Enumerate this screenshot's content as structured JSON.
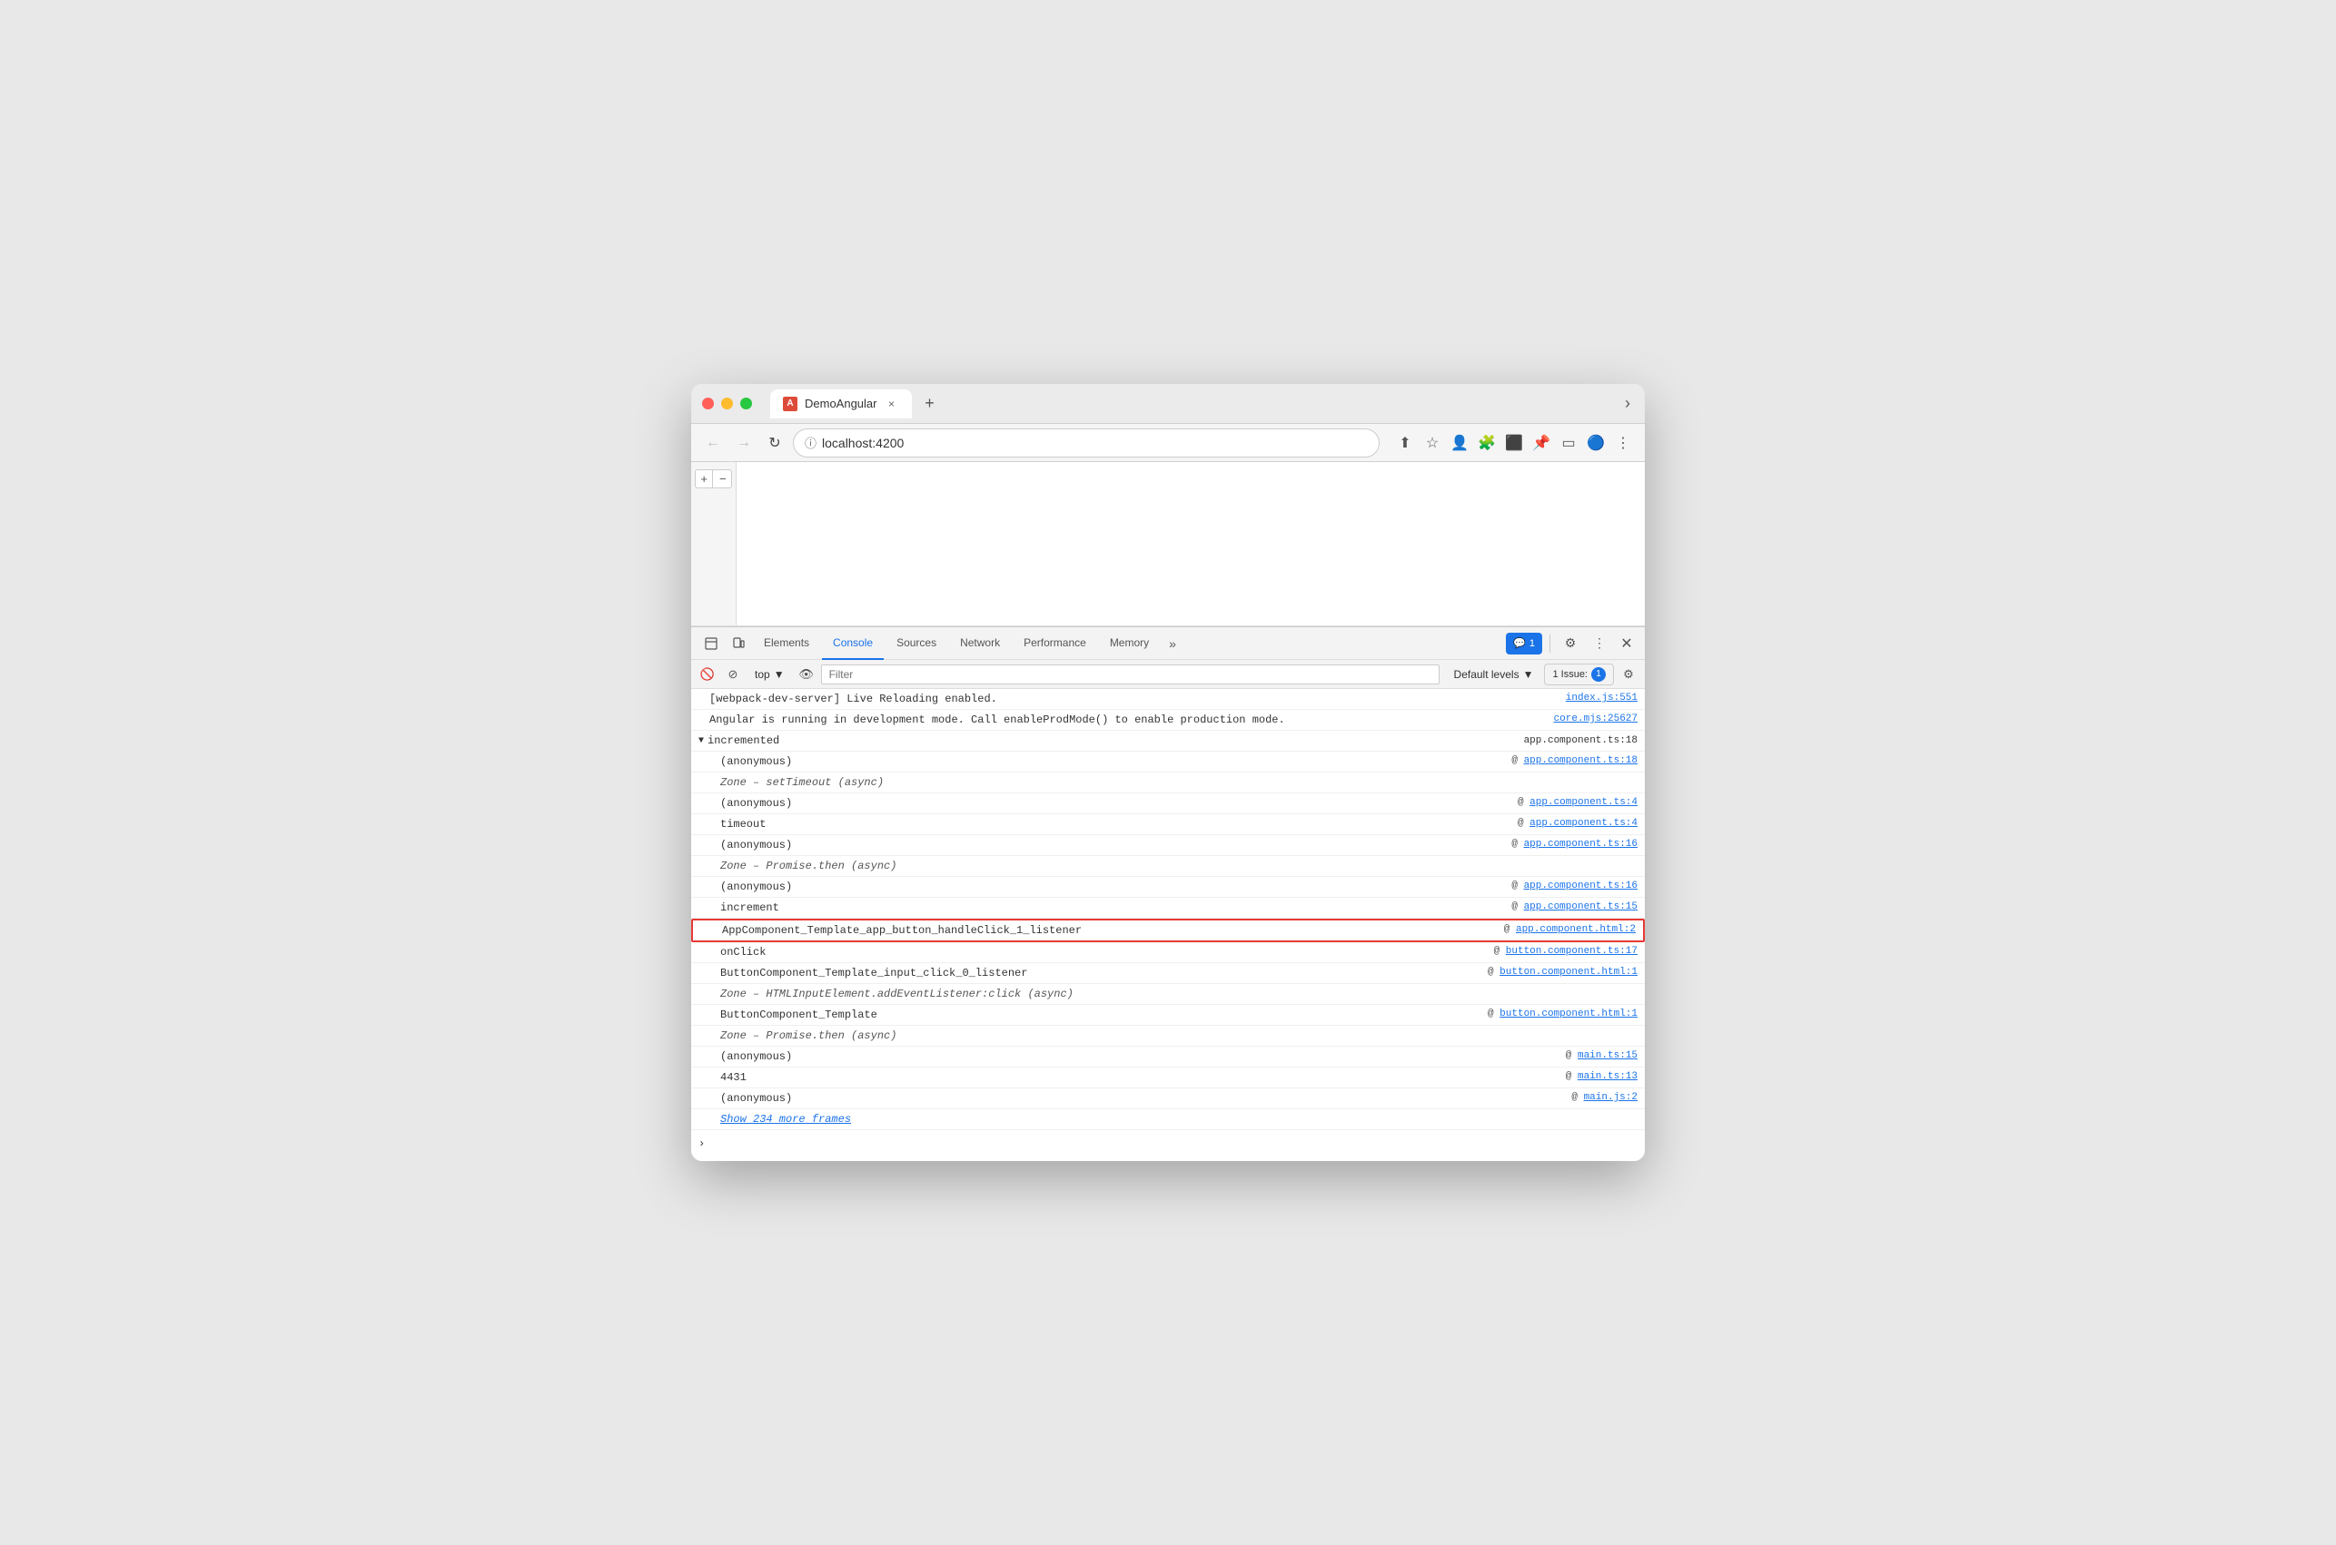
{
  "window": {
    "title": "DemoAngular",
    "url": "localhost:4200"
  },
  "traffic_lights": {
    "close": "close",
    "minimize": "minimize",
    "maximize": "maximize"
  },
  "tab": {
    "favicon": "A",
    "title": "DemoAngular",
    "close": "×"
  },
  "nav": {
    "back": "←",
    "forward": "→",
    "refresh": "↻",
    "url_icon": "ⓘ",
    "url": "localhost:4200"
  },
  "devtools": {
    "tabs": [
      "Elements",
      "Console",
      "Sources",
      "Network",
      "Performance",
      "Memory"
    ],
    "active_tab": "Console",
    "more": "»",
    "badge_label": "1",
    "badge_count": "1",
    "issue_label": "1 Issue:",
    "issue_count": "1"
  },
  "console_toolbar": {
    "context": "top",
    "filter_placeholder": "Filter",
    "default_levels": "Default levels",
    "issue_label": "1 Issue:",
    "issue_count": "1"
  },
  "console_entries": [
    {
      "type": "log",
      "message": "[webpack-dev-server] Live Reloading enabled.",
      "source": "index.js:551",
      "source_link": true,
      "indented": false,
      "highlighted": false
    },
    {
      "type": "log",
      "message": "Angular is running in development mode. Call enableProdMode() to enable production mode.",
      "source": "core.mjs:25627",
      "source_link": true,
      "indented": false,
      "highlighted": false
    },
    {
      "type": "section",
      "message": "▼ incremented",
      "source": "app.component.ts:18",
      "source_link": false,
      "indented": false,
      "highlighted": false
    },
    {
      "type": "log",
      "message": "(anonymous)",
      "source": "app.component.ts:18",
      "source_link": true,
      "source_prefix": "@ ",
      "indented": true,
      "highlighted": false
    },
    {
      "type": "log",
      "message": "Zone – setTimeout (async)",
      "source": "",
      "source_link": false,
      "indented": true,
      "highlighted": false,
      "italic": true
    },
    {
      "type": "log",
      "message": "(anonymous)",
      "source": "app.component.ts:4",
      "source_link": true,
      "source_prefix": "@ ",
      "indented": true,
      "highlighted": false
    },
    {
      "type": "log",
      "message": "timeout",
      "source": "app.component.ts:4",
      "source_link": true,
      "source_prefix": "@ ",
      "indented": true,
      "highlighted": false
    },
    {
      "type": "log",
      "message": "(anonymous)",
      "source": "app.component.ts:16",
      "source_link": true,
      "source_prefix": "@ ",
      "indented": true,
      "highlighted": false
    },
    {
      "type": "log",
      "message": "Zone – Promise.then (async)",
      "source": "",
      "source_link": false,
      "indented": true,
      "highlighted": false,
      "italic": true
    },
    {
      "type": "log",
      "message": "(anonymous)",
      "source": "app.component.ts:16",
      "source_link": true,
      "source_prefix": "@ ",
      "indented": true,
      "highlighted": false
    },
    {
      "type": "log",
      "message": "increment",
      "source": "app.component.ts:15",
      "source_link": true,
      "source_prefix": "@ ",
      "indented": true,
      "highlighted": false
    },
    {
      "type": "log",
      "message": "AppComponent_Template_app_button_handleClick_1_listener",
      "source": "app.component.html:2",
      "source_link": true,
      "source_prefix": "@ ",
      "indented": true,
      "highlighted": true
    },
    {
      "type": "log",
      "message": "onClick",
      "source": "button.component.ts:17",
      "source_link": true,
      "source_prefix": "@ ",
      "indented": true,
      "highlighted": false
    },
    {
      "type": "log",
      "message": "ButtonComponent_Template_input_click_0_listener",
      "source": "button.component.html:1",
      "source_link": true,
      "source_prefix": "@ ",
      "indented": true,
      "highlighted": false
    },
    {
      "type": "log",
      "message": "Zone – HTMLInputElement.addEventListener:click (async)",
      "source": "",
      "source_link": false,
      "indented": true,
      "highlighted": false,
      "italic": true
    },
    {
      "type": "log",
      "message": "ButtonComponent_Template",
      "source": "button.component.html:1",
      "source_link": true,
      "source_prefix": "@ ",
      "indented": true,
      "highlighted": false
    },
    {
      "type": "log",
      "message": "Zone – Promise.then (async)",
      "source": "",
      "source_link": false,
      "indented": true,
      "highlighted": false,
      "italic": true
    },
    {
      "type": "log",
      "message": "(anonymous)",
      "source": "main.ts:15",
      "source_link": true,
      "source_prefix": "@ ",
      "indented": true,
      "highlighted": false
    },
    {
      "type": "log",
      "message": "4431",
      "source": "main.ts:13",
      "source_link": true,
      "source_prefix": "@ ",
      "indented": true,
      "highlighted": false
    },
    {
      "type": "log",
      "message": "(anonymous)",
      "source": "main.js:2",
      "source_link": true,
      "source_prefix": "@ ",
      "indented": true,
      "highlighted": false
    },
    {
      "type": "show_more",
      "message": "Show 234 more frames",
      "indented": true,
      "highlighted": false
    }
  ],
  "sidebar": {
    "plus": "+",
    "minus": "−"
  }
}
